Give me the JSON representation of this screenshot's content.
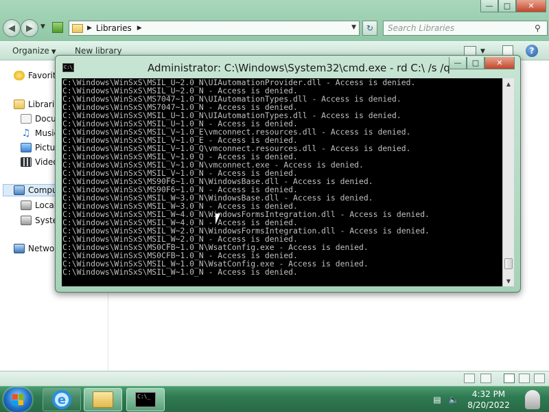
{
  "explorer": {
    "breadcrumb": {
      "location": "Libraries"
    },
    "search": {
      "placeholder": "Search Libraries"
    },
    "toolbar": {
      "organize_label": "Organize",
      "new_library_label": "New library"
    },
    "nav_pane": {
      "favorites_label": "Favorite",
      "libraries_label": "Libraries",
      "libraries_items": [
        "Docu",
        "Music",
        "Picture",
        "Videos"
      ],
      "computer_label": "Compute",
      "computer_items": [
        "Local D",
        "System"
      ],
      "network_label": "Network"
    },
    "help_glyph": "?"
  },
  "cmd": {
    "title": "Administrator: C:\\Windows\\System32\\cmd.exe - rd  C:\\ /s /q",
    "icon_glyph": "C:\\_",
    "lines": [
      "C:\\Windows\\WinSxS\\MSIL_U~2.0_N\\UIAutomationProvider.dll - Access is denied.",
      "C:\\Windows\\WinSxS\\MSIL_U~2.0_N - Access is denied.",
      "C:\\Windows\\WinSxS\\MS7047~1.0_N\\UIAutomationTypes.dll - Access is denied.",
      "C:\\Windows\\WinSxS\\MS7047~1.0_N - Access is denied.",
      "C:\\Windows\\WinSxS\\MSIL_U~1.0_N\\UIAutomationTypes.dll - Access is denied.",
      "C:\\Windows\\WinSxS\\MSIL_U~1.0_N - Access is denied.",
      "C:\\Windows\\WinSxS\\MSIL_V~1.0_E\\vmconnect.resources.dll - Access is denied.",
      "C:\\Windows\\WinSxS\\MSIL_V~1.0_E - Access is denied.",
      "C:\\Windows\\WinSxS\\MSIL_V~1.0_Q\\vmconnect.resources.dll - Access is denied.",
      "C:\\Windows\\WinSxS\\MSIL_V~1.0_Q - Access is denied.",
      "C:\\Windows\\WinSxS\\MSIL_V~1.0_N\\vmconnect.exe - Access is denied.",
      "C:\\Windows\\WinSxS\\MSIL_V~1.0_N - Access is denied.",
      "C:\\Windows\\WinSxS\\MS90F6~1.0_N\\WindowsBase.dll - Access is denied.",
      "C:\\Windows\\WinSxS\\MS90F6~1.0_N - Access is denied.",
      "C:\\Windows\\WinSxS\\MSIL_W~3.0_N\\WindowsBase.dll - Access is denied.",
      "C:\\Windows\\WinSxS\\MSIL_W~3.0_N - Access is denied.",
      "C:\\Windows\\WinSxS\\MSIL_W~4.0_N\\WindowsFormsIntegration.dll - Access is denied.",
      "C:\\Windows\\WinSxS\\MSIL_W~4.0_N - Access is denied.",
      "C:\\Windows\\WinSxS\\MSIL_W~2.0_N\\WindowsFormsIntegration.dll - Access is denied.",
      "C:\\Windows\\WinSxS\\MSIL_W~2.0_N - Access is denied.",
      "C:\\Windows\\WinSxS\\MS0CFB~1.0_N\\WsatConfig.exe - Access is denied.",
      "C:\\Windows\\WinSxS\\MS0CFB~1.0_N - Access is denied.",
      "C:\\Windows\\WinSxS\\MSIL_W~1.0_N\\WsatConfig.exe - Access is denied.",
      "C:\\Windows\\WinSxS\\MSIL_W~1.0_N - Access is denied."
    ]
  },
  "taskbar": {
    "time": "4:32 PM",
    "date": "8/20/2022",
    "cmd_icon_glyph": "C:\\_",
    "ie_glyph": "e"
  }
}
